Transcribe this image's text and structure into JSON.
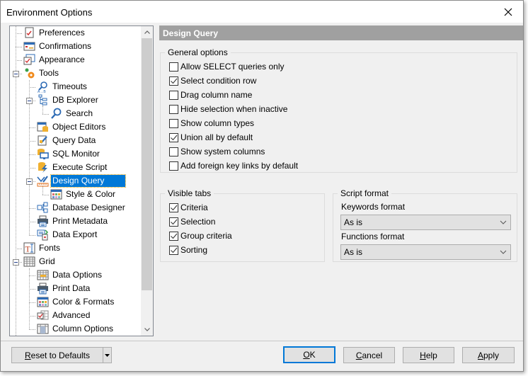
{
  "window": {
    "title": "Environment Options",
    "close_icon": "close-icon"
  },
  "tree": {
    "items": [
      {
        "label": "Preferences",
        "icon": "preferences-icon",
        "level": 1
      },
      {
        "label": "Confirmations",
        "icon": "confirmations-icon",
        "level": 1
      },
      {
        "label": "Appearance",
        "icon": "appearance-icon",
        "level": 1
      },
      {
        "label": "Tools",
        "icon": "tools-gear-icon",
        "level": 1,
        "expanded": true
      },
      {
        "label": "Timeouts",
        "icon": "timeouts-icon",
        "level": 2
      },
      {
        "label": "DB Explorer",
        "icon": "db-explorer-icon",
        "level": 2,
        "expanded": true
      },
      {
        "label": "Search",
        "icon": "search-icon",
        "level": 3
      },
      {
        "label": "Object Editors",
        "icon": "object-editors-icon",
        "level": 2
      },
      {
        "label": "Query Data",
        "icon": "query-data-icon",
        "level": 2
      },
      {
        "label": "SQL Monitor",
        "icon": "sql-monitor-icon",
        "level": 2
      },
      {
        "label": "Execute Script",
        "icon": "execute-script-icon",
        "level": 2
      },
      {
        "label": "Design Query",
        "icon": "design-query-icon",
        "level": 2,
        "expanded": true,
        "selected": true
      },
      {
        "label": "Style & Color",
        "icon": "style-color-icon",
        "level": 3
      },
      {
        "label": "Database Designer",
        "icon": "database-designer-icon",
        "level": 2
      },
      {
        "label": "Print Metadata",
        "icon": "printer-icon",
        "level": 2
      },
      {
        "label": "Data Export",
        "icon": "data-export-icon",
        "level": 2
      },
      {
        "label": "Fonts",
        "icon": "fonts-icon",
        "level": 1
      },
      {
        "label": "Grid",
        "icon": "grid-icon",
        "level": 1,
        "expanded": true
      },
      {
        "label": "Data Options",
        "icon": "data-options-icon",
        "level": 2
      },
      {
        "label": "Print Data",
        "icon": "printer-icon",
        "level": 2
      },
      {
        "label": "Color & Formats",
        "icon": "color-formats-icon",
        "level": 2
      },
      {
        "label": "Advanced",
        "icon": "advanced-icon",
        "level": 2
      },
      {
        "label": "Column Options",
        "icon": "column-options-icon",
        "level": 2
      }
    ]
  },
  "panel": {
    "header": "Design Query",
    "general_options": {
      "title": "General options",
      "checkboxes": [
        {
          "label": "Allow SELECT queries only",
          "checked": false
        },
        {
          "label": "Select condition row",
          "checked": true
        },
        {
          "label": "Drag column name",
          "checked": false
        },
        {
          "label": "Hide selection when inactive",
          "checked": false
        },
        {
          "label": "Show column types",
          "checked": false
        },
        {
          "label": "Union all by default",
          "checked": true
        },
        {
          "label": "Show system columns",
          "checked": false
        },
        {
          "label": "Add foreign key links by default",
          "checked": false
        }
      ]
    },
    "visible_tabs": {
      "title": "Visible tabs",
      "checkboxes": [
        {
          "label": "Criteria",
          "checked": true
        },
        {
          "label": "Selection",
          "checked": true
        },
        {
          "label": "Group criteria",
          "checked": true
        },
        {
          "label": "Sorting",
          "checked": true
        }
      ]
    },
    "script_format": {
      "title": "Script format",
      "keywords_label": "Keywords format",
      "keywords_value": "As is",
      "functions_label": "Functions format",
      "functions_value": "As is"
    }
  },
  "footer": {
    "reset": {
      "mnemonic": "R",
      "rest": "eset to Defaults"
    },
    "ok": {
      "mnemonic": "O",
      "rest": "K"
    },
    "cancel": {
      "mnemonic": "C",
      "rest": "ancel"
    },
    "help": {
      "mnemonic": "H",
      "rest": "elp"
    },
    "apply": {
      "mnemonic": "A",
      "rest": "pply"
    }
  },
  "colors": {
    "selection": "#0078d7",
    "header_bg": "#a0a0a0",
    "dialog_bg": "#f0f0f0"
  }
}
